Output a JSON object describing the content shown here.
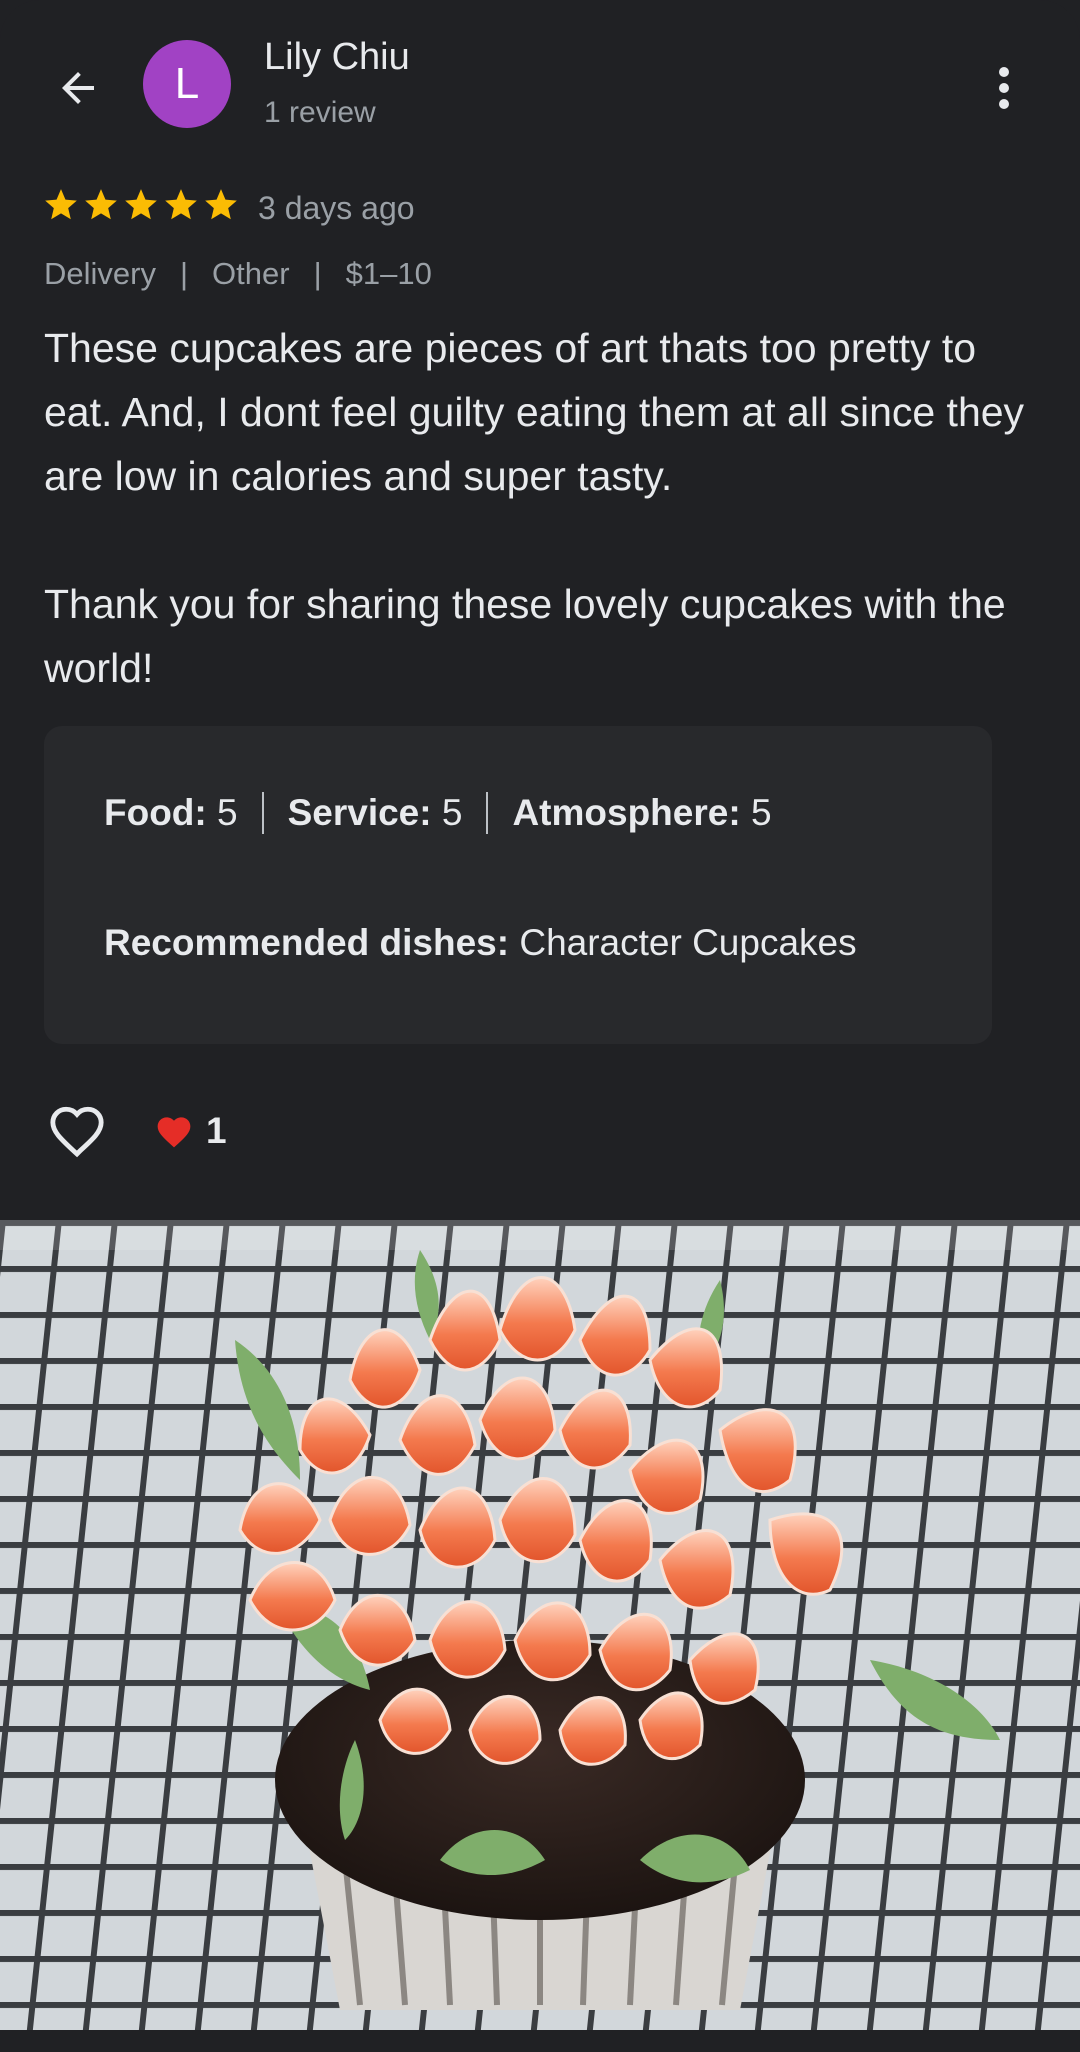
{
  "header": {
    "avatar_letter": "L",
    "avatar_color": "#a142c4",
    "user_name": "Lily Chiu",
    "user_sub": "1 review",
    "back_icon": "arrow-back-icon",
    "more_icon": "more-vert-icon"
  },
  "review": {
    "stars": 5,
    "star_color": "#fbbc04",
    "time_ago": "3 days ago",
    "meta": [
      "Delivery",
      "Other",
      "$1–10"
    ],
    "paragraphs": [
      "These cupcakes are pieces of art thats too pretty to eat. And, I dont feel guilty eating them at all since they are low in calories and super tasty.",
      "Thank you for sharing these lovely cupcakes with the world!"
    ]
  },
  "ratings_card": {
    "food_label": "Food:",
    "food_value": "5",
    "service_label": "Service:",
    "service_value": "5",
    "atmosphere_label": "Atmosphere:",
    "atmosphere_value": "5",
    "recommended_label": "Recommended dishes:",
    "recommended_value": "Character Cupcakes"
  },
  "reactions": {
    "like_icon": "heart-outline-icon",
    "reaction_icon": "red-heart-icon",
    "count": "1"
  },
  "photo": {
    "subject": "cupcake-photo"
  }
}
